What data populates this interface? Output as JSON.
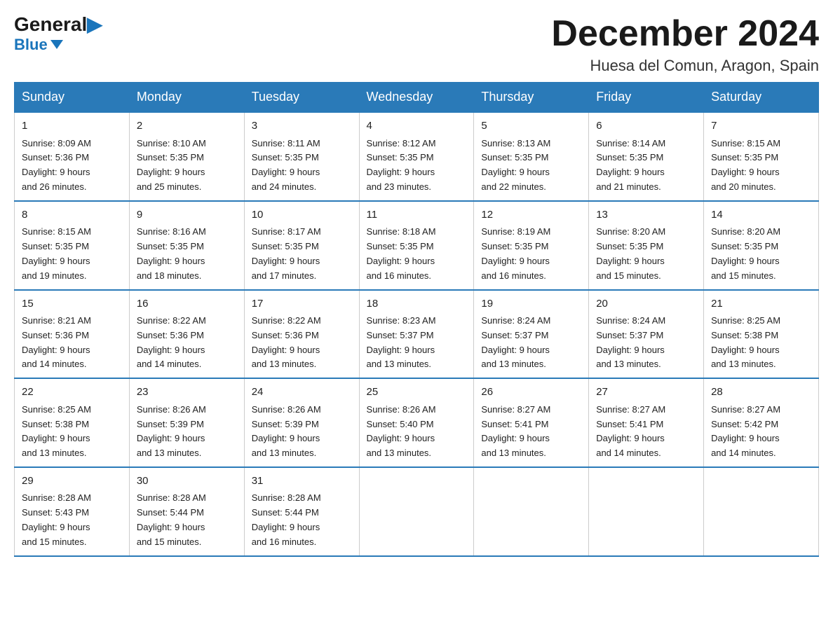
{
  "logo": {
    "general": "General",
    "blue": "Blue"
  },
  "title": "December 2024",
  "location": "Huesa del Comun, Aragon, Spain",
  "days_of_week": [
    "Sunday",
    "Monday",
    "Tuesday",
    "Wednesday",
    "Thursday",
    "Friday",
    "Saturday"
  ],
  "weeks": [
    [
      {
        "day": "1",
        "sunrise": "8:09 AM",
        "sunset": "5:36 PM",
        "daylight": "9 hours and 26 minutes."
      },
      {
        "day": "2",
        "sunrise": "8:10 AM",
        "sunset": "5:35 PM",
        "daylight": "9 hours and 25 minutes."
      },
      {
        "day": "3",
        "sunrise": "8:11 AM",
        "sunset": "5:35 PM",
        "daylight": "9 hours and 24 minutes."
      },
      {
        "day": "4",
        "sunrise": "8:12 AM",
        "sunset": "5:35 PM",
        "daylight": "9 hours and 23 minutes."
      },
      {
        "day": "5",
        "sunrise": "8:13 AM",
        "sunset": "5:35 PM",
        "daylight": "9 hours and 22 minutes."
      },
      {
        "day": "6",
        "sunrise": "8:14 AM",
        "sunset": "5:35 PM",
        "daylight": "9 hours and 21 minutes."
      },
      {
        "day": "7",
        "sunrise": "8:15 AM",
        "sunset": "5:35 PM",
        "daylight": "9 hours and 20 minutes."
      }
    ],
    [
      {
        "day": "8",
        "sunrise": "8:15 AM",
        "sunset": "5:35 PM",
        "daylight": "9 hours and 19 minutes."
      },
      {
        "day": "9",
        "sunrise": "8:16 AM",
        "sunset": "5:35 PM",
        "daylight": "9 hours and 18 minutes."
      },
      {
        "day": "10",
        "sunrise": "8:17 AM",
        "sunset": "5:35 PM",
        "daylight": "9 hours and 17 minutes."
      },
      {
        "day": "11",
        "sunrise": "8:18 AM",
        "sunset": "5:35 PM",
        "daylight": "9 hours and 16 minutes."
      },
      {
        "day": "12",
        "sunrise": "8:19 AM",
        "sunset": "5:35 PM",
        "daylight": "9 hours and 16 minutes."
      },
      {
        "day": "13",
        "sunrise": "8:20 AM",
        "sunset": "5:35 PM",
        "daylight": "9 hours and 15 minutes."
      },
      {
        "day": "14",
        "sunrise": "8:20 AM",
        "sunset": "5:35 PM",
        "daylight": "9 hours and 15 minutes."
      }
    ],
    [
      {
        "day": "15",
        "sunrise": "8:21 AM",
        "sunset": "5:36 PM",
        "daylight": "9 hours and 14 minutes."
      },
      {
        "day": "16",
        "sunrise": "8:22 AM",
        "sunset": "5:36 PM",
        "daylight": "9 hours and 14 minutes."
      },
      {
        "day": "17",
        "sunrise": "8:22 AM",
        "sunset": "5:36 PM",
        "daylight": "9 hours and 13 minutes."
      },
      {
        "day": "18",
        "sunrise": "8:23 AM",
        "sunset": "5:37 PM",
        "daylight": "9 hours and 13 minutes."
      },
      {
        "day": "19",
        "sunrise": "8:24 AM",
        "sunset": "5:37 PM",
        "daylight": "9 hours and 13 minutes."
      },
      {
        "day": "20",
        "sunrise": "8:24 AM",
        "sunset": "5:37 PM",
        "daylight": "9 hours and 13 minutes."
      },
      {
        "day": "21",
        "sunrise": "8:25 AM",
        "sunset": "5:38 PM",
        "daylight": "9 hours and 13 minutes."
      }
    ],
    [
      {
        "day": "22",
        "sunrise": "8:25 AM",
        "sunset": "5:38 PM",
        "daylight": "9 hours and 13 minutes."
      },
      {
        "day": "23",
        "sunrise": "8:26 AM",
        "sunset": "5:39 PM",
        "daylight": "9 hours and 13 minutes."
      },
      {
        "day": "24",
        "sunrise": "8:26 AM",
        "sunset": "5:39 PM",
        "daylight": "9 hours and 13 minutes."
      },
      {
        "day": "25",
        "sunrise": "8:26 AM",
        "sunset": "5:40 PM",
        "daylight": "9 hours and 13 minutes."
      },
      {
        "day": "26",
        "sunrise": "8:27 AM",
        "sunset": "5:41 PM",
        "daylight": "9 hours and 13 minutes."
      },
      {
        "day": "27",
        "sunrise": "8:27 AM",
        "sunset": "5:41 PM",
        "daylight": "9 hours and 14 minutes."
      },
      {
        "day": "28",
        "sunrise": "8:27 AM",
        "sunset": "5:42 PM",
        "daylight": "9 hours and 14 minutes."
      }
    ],
    [
      {
        "day": "29",
        "sunrise": "8:28 AM",
        "sunset": "5:43 PM",
        "daylight": "9 hours and 15 minutes."
      },
      {
        "day": "30",
        "sunrise": "8:28 AM",
        "sunset": "5:44 PM",
        "daylight": "9 hours and 15 minutes."
      },
      {
        "day": "31",
        "sunrise": "8:28 AM",
        "sunset": "5:44 PM",
        "daylight": "9 hours and 16 minutes."
      },
      null,
      null,
      null,
      null
    ]
  ],
  "labels": {
    "sunrise": "Sunrise:",
    "sunset": "Sunset:",
    "daylight": "Daylight:"
  },
  "colors": {
    "header_bg": "#2a7ab8",
    "header_text": "#ffffff",
    "border": "#2a7ab8"
  }
}
